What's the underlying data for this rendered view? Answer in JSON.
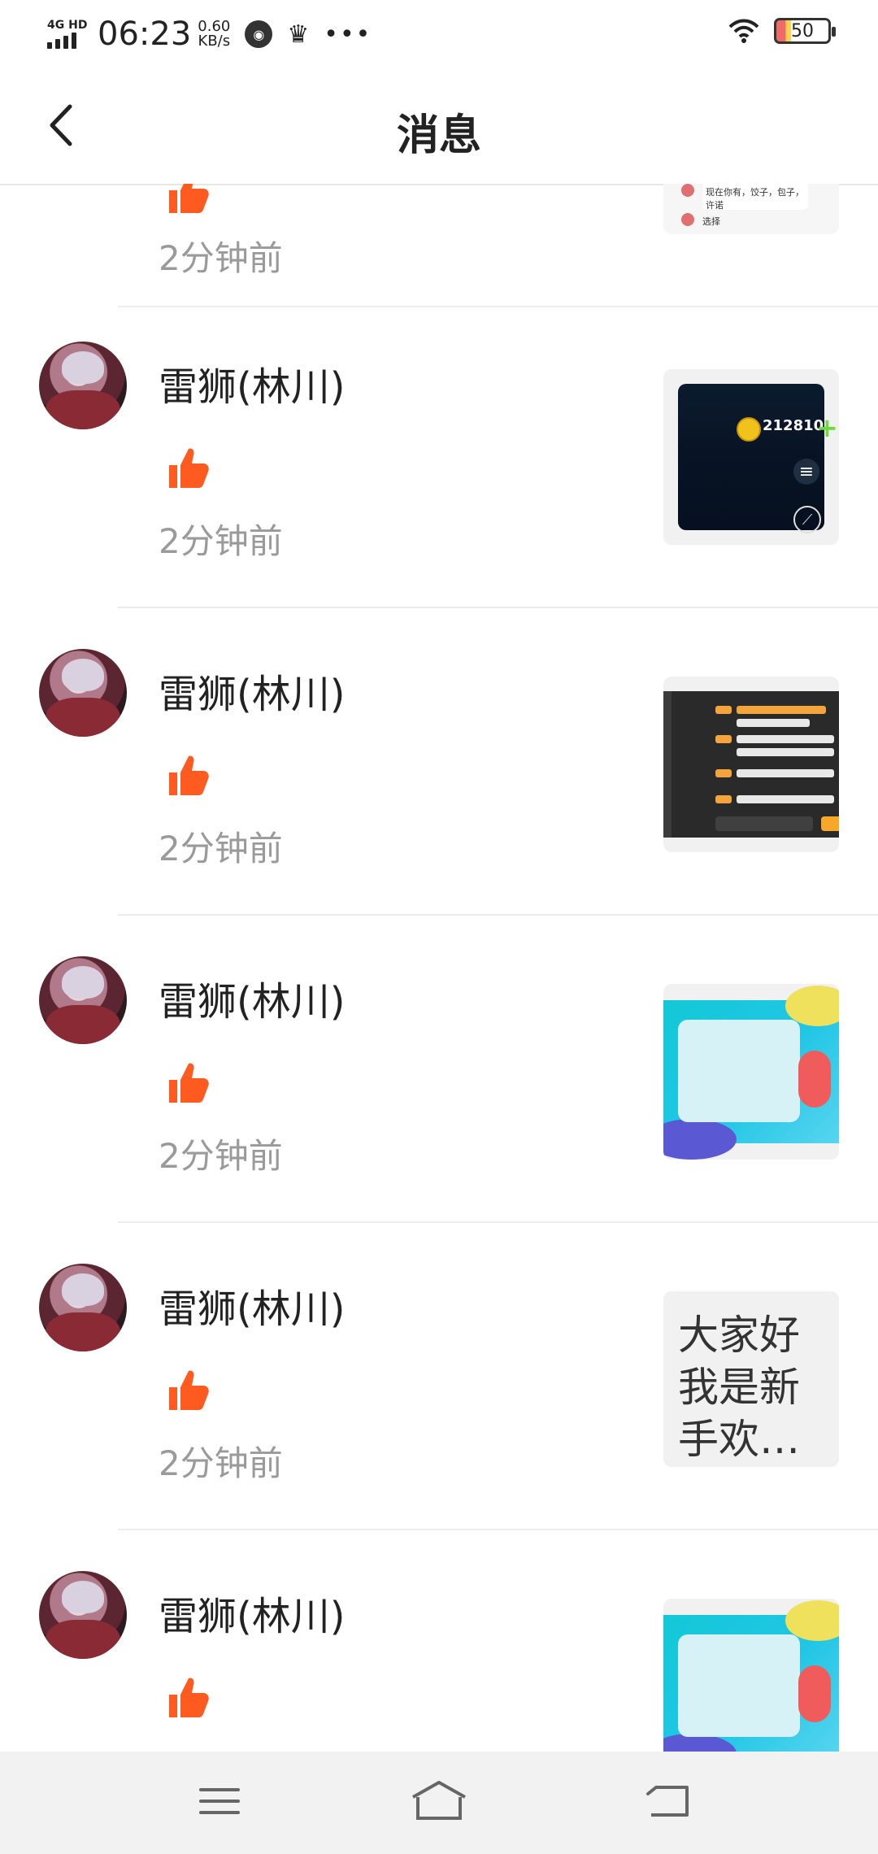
{
  "status": {
    "network": "4G HD",
    "time": "06:23",
    "speed_value": "0.60",
    "speed_unit": "KB/s",
    "battery": "50"
  },
  "header": {
    "title": "消息"
  },
  "top_partial_thumb_lines": [
    "现在你有，饺子，包子，许诺",
    "选择"
  ],
  "messages": [
    {
      "username": "雷狮(林川)",
      "time": "2分钟前",
      "thumb_type": "game",
      "thumb_value": "212810"
    },
    {
      "username": "雷狮(林川)",
      "time": "2分钟前",
      "thumb_type": "chat"
    },
    {
      "username": "雷狮(林川)",
      "time": "2分钟前",
      "thumb_type": "profile"
    },
    {
      "username": "雷狮(林川)",
      "time": "2分钟前",
      "thumb_type": "text",
      "thumb_text": "大家好\n我是新\n手欢…"
    },
    {
      "username": "雷狮(林川)",
      "time": "",
      "thumb_type": "profile"
    }
  ],
  "top_time": "2分钟前",
  "colors": {
    "accent": "#ff5a1f",
    "divider": "#ededed",
    "secondary_text": "#9a9a9a"
  }
}
